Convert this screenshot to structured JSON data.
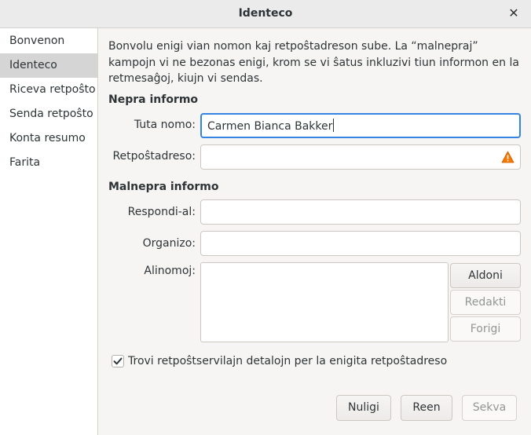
{
  "window": {
    "title": "Identeco",
    "close_glyph": "✕"
  },
  "sidebar": {
    "items": [
      {
        "label": "Bonvenon",
        "selected": false
      },
      {
        "label": "Identeco",
        "selected": true
      },
      {
        "label": "Riceva retpoŝto",
        "selected": false
      },
      {
        "label": "Senda retpoŝto",
        "selected": false
      },
      {
        "label": "Konta resumo",
        "selected": false
      },
      {
        "label": "Farita",
        "selected": false
      }
    ]
  },
  "main": {
    "description": "Bonvolu enigi vian nomon kaj retpoŝtadreson sube. La “malnepraj” kampojn vi ne bezonas enigi, krom se vi ŝatus inkluzivi tiun informon en la retmesaĝoj, kiujn vi sendas.",
    "required_heading": "Nepra informo",
    "full_name": {
      "label": "Tuta nomo:",
      "value": "Carmen Bianca Bakker"
    },
    "email": {
      "label": "Retpoŝtadreso:",
      "value": "",
      "status_icon": "warning-icon"
    },
    "optional_heading": "Malnepra informo",
    "reply_to": {
      "label": "Respondi-al:",
      "value": ""
    },
    "organization": {
      "label": "Organizo:",
      "value": ""
    },
    "aliases": {
      "label": "Alinomoj:",
      "add_label": "Aldoni",
      "edit_label": "Redakti",
      "remove_label": "Forigi"
    },
    "lookup": {
      "checked": true,
      "label": "Trovi retpoŝtservilajn detalojn per la enigita retpoŝtadreso"
    }
  },
  "footer": {
    "cancel_label": "Nuligi",
    "back_label": "Reen",
    "next_label": "Sekva"
  },
  "colors": {
    "accent": "#3584e4",
    "warning": "#f57900",
    "selected_row": "#d5d5d5"
  }
}
